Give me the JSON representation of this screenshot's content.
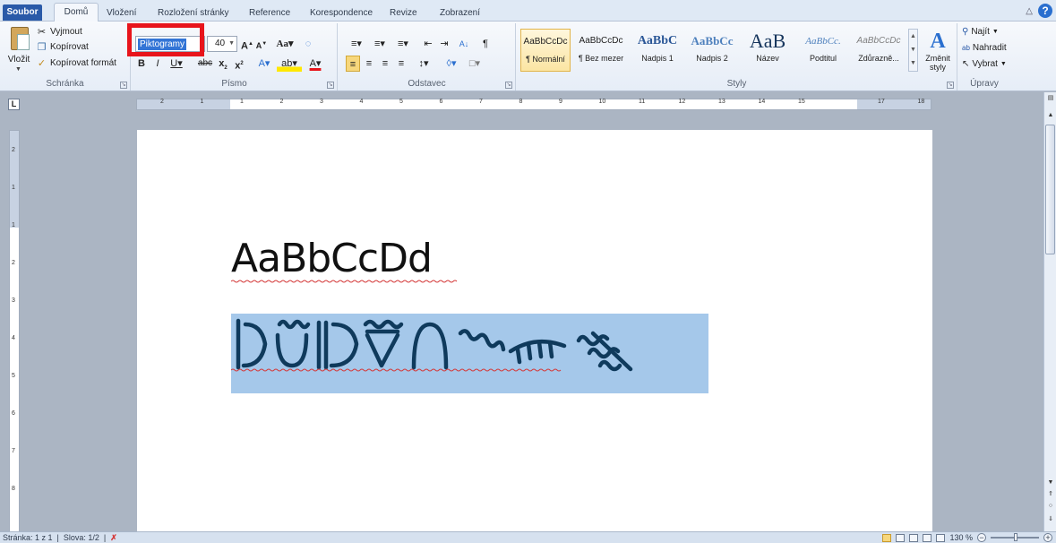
{
  "tabs": [
    "Soubor",
    "Domů",
    "Vložení",
    "Rozložení stránky",
    "Reference",
    "Korespondence",
    "Revize",
    "Zobrazení"
  ],
  "clipboard": {
    "paste_label": "Vložit",
    "cut_label": "Vyjmout",
    "copy_label": "Kopírovat",
    "format_painter_label": "Kopírovat formát",
    "group_label": "Schránka"
  },
  "font": {
    "name": "Piktogramy",
    "size": "40",
    "group_label": "Písmo"
  },
  "paragraph": {
    "group_label": "Odstavec"
  },
  "styles": {
    "group_label": "Styly",
    "items": [
      {
        "sample": "AaBbCcDc",
        "name": "¶ Normální",
        "color": "#000000"
      },
      {
        "sample": "AaBbCcDc",
        "name": "¶ Bez mezer",
        "color": "#000000"
      },
      {
        "sample": "AaBbC",
        "name": "Nadpis 1",
        "color": "#2b5797"
      },
      {
        "sample": "AaBbCc",
        "name": "Nadpis 2",
        "color": "#4f81bd"
      },
      {
        "sample": "AaB",
        "name": "Název",
        "color": "#17365d"
      },
      {
        "sample": "AaBbCc.",
        "name": "Podtitul",
        "color": "#4f81bd"
      },
      {
        "sample": "AaBbCcDc",
        "name": "Zdůrazně...",
        "color": "#7f7f7f"
      }
    ],
    "change_styles_label": "Změnit styly"
  },
  "editing": {
    "find_label": "Najít",
    "replace_label": "Nahradit",
    "select_label": "Vybrat",
    "group_label": "Úpravy"
  },
  "ruler": {
    "h_numbers": [
      "2",
      "1",
      "1",
      "2",
      "3",
      "4",
      "5",
      "6",
      "7",
      "8",
      "9",
      "10",
      "11",
      "12",
      "13",
      "14",
      "15",
      "17",
      "18"
    ],
    "v_numbers": [
      "2",
      "1",
      "1",
      "2",
      "3",
      "4",
      "5",
      "6",
      "7",
      "8"
    ]
  },
  "document": {
    "sample_text": "AaBbCcDd"
  },
  "status": {
    "page": "Stránka: 1 z 1",
    "words": "Slova: 1/2",
    "zoom": "130 %"
  },
  "colors": {
    "accent": "#2a5aa8",
    "highlight_box": "#e8141b",
    "selection": "#a5c8ea"
  }
}
